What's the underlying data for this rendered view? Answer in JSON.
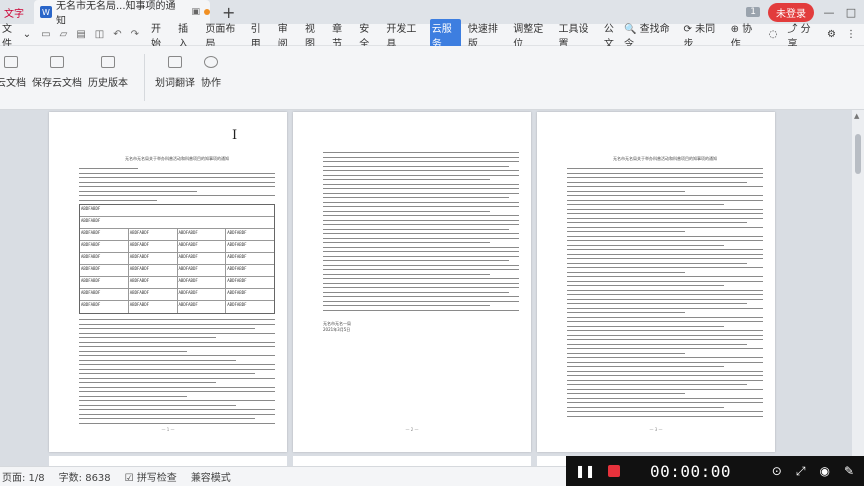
{
  "tabbar": {
    "app_label": "文字",
    "doc_title": "无名市无名局...知事项的通知",
    "add_tab": "+",
    "page_count_badge": "1",
    "login_label": "未登录",
    "win_minimize": "—",
    "win_maximize": "□",
    "win_close": "✕"
  },
  "menubar": {
    "file_label": "文件",
    "items": [
      "开始",
      "插入",
      "页面布局",
      "引用",
      "审阅",
      "视图",
      "章节",
      "安全",
      "开发工具",
      "云服务",
      "快速排版",
      "调整定位",
      "工具设置",
      "公文"
    ],
    "active_item": "云服务",
    "search_label": "查找命令",
    "sync_label": "未同步",
    "collab_label": "协作",
    "share_label": "分享"
  },
  "ribbon": {
    "buttons": [
      "云文档",
      "保存云文档",
      "历史版本",
      "划词翻译",
      "协作"
    ]
  },
  "document": {
    "page1_title": "无名市无名局关于举办科普活动和科普项目的知事项的通知",
    "page3_title": "无名市无名局关于举办科普活动和科普项目的知事项的通知",
    "table_row_text": "ABDFABDF",
    "page2_sign": "无名市无名一局",
    "page2_date": "2021年3月5日"
  },
  "statusbar": {
    "page_label": "页面: 1/8",
    "word_count": "字数: 8638",
    "spell_check": "拼写检查",
    "compat_mode": "兼容模式"
  },
  "recorder": {
    "time": "00:00:00"
  }
}
